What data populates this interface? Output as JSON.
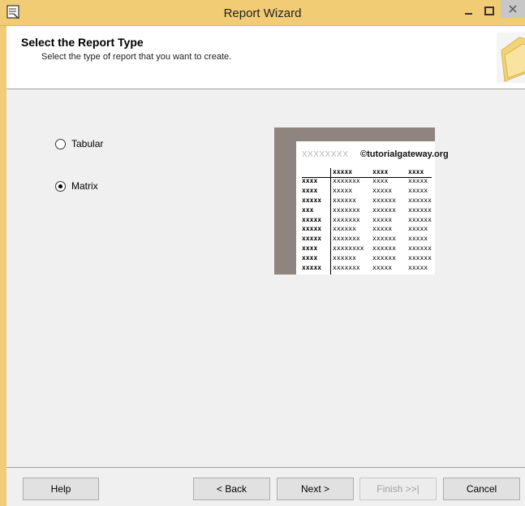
{
  "window": {
    "title": "Report Wizard"
  },
  "header": {
    "title": "Select the Report Type",
    "subtitle": "Select the type of report that you want to create."
  },
  "options": [
    {
      "label": "Tabular",
      "selected": false
    },
    {
      "label": "Matrix",
      "selected": true
    }
  ],
  "preview": {
    "placeholder": "XXXXXXXX",
    "watermark": "©tutorialgateway.org",
    "header_cells": [
      "xxxxx",
      "xxxx",
      "xxxx"
    ],
    "rows": [
      [
        "xxxx",
        "xxxxxxx",
        "xxxx",
        "xxxxx"
      ],
      [
        "xxxx",
        "xxxxx",
        "xxxxx",
        "xxxxx"
      ],
      [
        "xxxxx",
        "xxxxxx",
        "xxxxxx",
        "xxxxxx"
      ],
      [
        "xxx",
        "xxxxxxx",
        "xxxxxx",
        "xxxxxx"
      ],
      [
        "xxxxx",
        "xxxxxxx",
        "xxxxx",
        "xxxxxx"
      ],
      [
        "xxxxx",
        "xxxxxx",
        "xxxxx",
        "xxxxx"
      ],
      [
        "xxxxx",
        "xxxxxxx",
        "xxxxxx",
        "xxxxx"
      ],
      [
        "xxxx",
        "xxxxxxxx",
        "xxxxxx",
        "xxxxxx"
      ],
      [
        "xxxx",
        "xxxxxx",
        "xxxxxx",
        "xxxxxx"
      ],
      [
        "xxxxx",
        "xxxxxxx",
        "xxxxx",
        "xxxxx"
      ]
    ]
  },
  "buttons": {
    "help": "Help",
    "back": "< Back",
    "next": "Next >",
    "finish": "Finish >>|",
    "cancel": "Cancel"
  },
  "colors": {
    "titlebar": "#f2cc75",
    "preview_frame": "#8e8581"
  }
}
